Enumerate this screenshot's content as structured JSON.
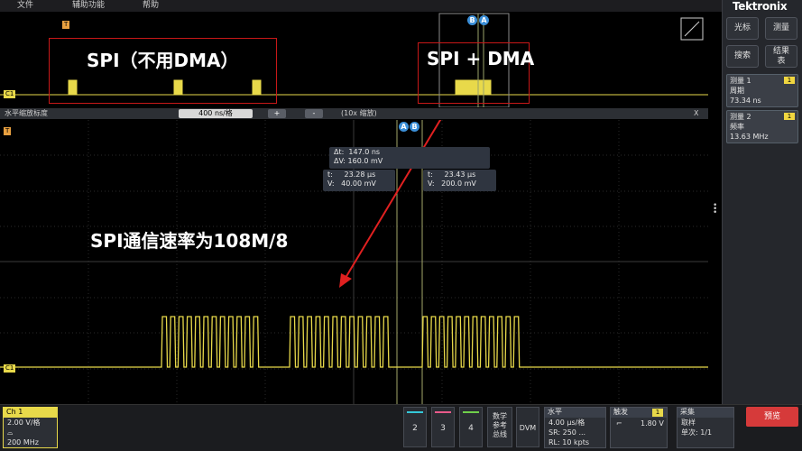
{
  "menu": {
    "file": "文件",
    "utility": "辅助功能",
    "help": "帮助"
  },
  "brand": {
    "logo": "Tektronix"
  },
  "right_panel": {
    "cursor_btn": "光标",
    "measure_btn": "测量",
    "search_btn": "搜索",
    "results_btn": "结果表"
  },
  "measurements": [
    {
      "title": "测量 1",
      "badge": "1",
      "name": "周期",
      "value": "73.34 ns"
    },
    {
      "title": "测量 2",
      "badge": "1",
      "name": "频率",
      "value": "13.63 MHz"
    }
  ],
  "overview": {
    "annotation_left": "SPI（不用DMA）",
    "annotation_right": "SPI + DMA",
    "channel_tag": "C1",
    "trigger_tag": "T",
    "cursor_b": "B",
    "cursor_a": "A"
  },
  "zoom_bar": {
    "title": "水平缩放标度",
    "scale_value": "400 ns/格",
    "plus": "+",
    "minus": "-",
    "zoom_factor": "(10x 缩放)",
    "close": "X"
  },
  "main": {
    "trigger_tag": "T",
    "channel_tag": "C1",
    "cursor_a": "A",
    "cursor_b": "B",
    "delta_t": "Δt:  147.0 ns",
    "delta_v": "ΔV: 160.0 mV",
    "cursor_a_t": "t:     23.28 µs",
    "cursor_a_v": "V:   40.00 mV",
    "cursor_b_t": "t:     23.43 µs",
    "cursor_b_v": "V:   200.0 mV",
    "annotation": "SPI通信速率为108M/8"
  },
  "bottom": {
    "ch1": {
      "title": "Ch 1",
      "scale": "2.00 V/格",
      "coupling": "⌓",
      "bandwidth": "200 MHz"
    },
    "ch2": "2",
    "ch3": "3",
    "ch4": "4",
    "math": "数学\n参考\n总线",
    "dvm": "DVM",
    "horizontal": {
      "title": "水平",
      "scale": "4.00 µs/格",
      "sr": "SR: 250 ...",
      "rl": "RL: 10 kpts"
    },
    "trigger": {
      "title": "触发",
      "badge": "1",
      "slope": "⌐",
      "level": "1.80 V"
    },
    "acquire": {
      "title": "采集",
      "mode": "取样",
      "single": "单次: 1/1"
    },
    "preview_btn": "预览"
  },
  "colors": {
    "ch1": "#e8d94a",
    "ch2": "#34c7d8",
    "ch3": "#e85a8a",
    "ch4": "#6fcf4a",
    "annotation_red": "#e02020",
    "cursor_blue": "#3b8fd8",
    "preview_btn": "#d63a3a"
  }
}
